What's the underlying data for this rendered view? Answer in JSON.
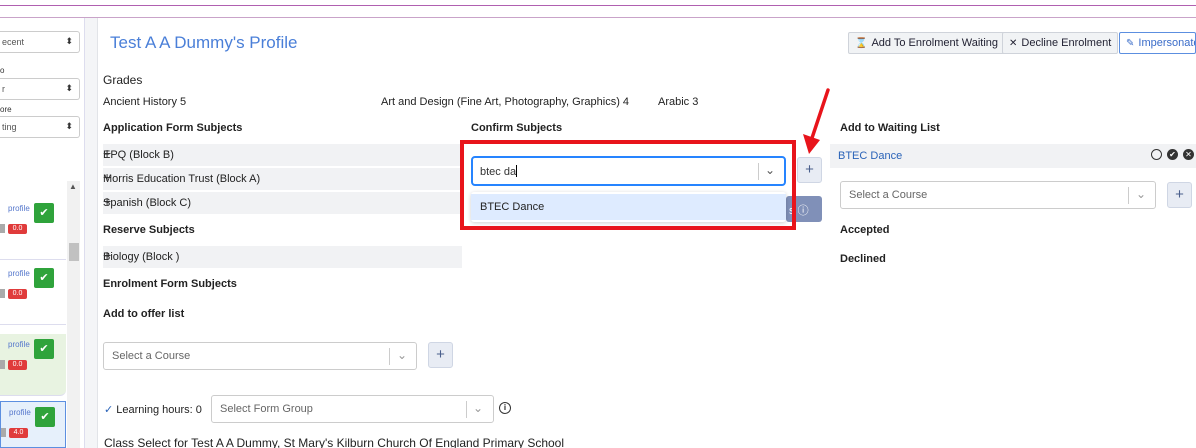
{
  "sidebar": {
    "select1": "ecent",
    "select2": "r",
    "select3": "ting",
    "label1": "o",
    "label2": "ore",
    "cards": [
      {
        "link": "profile",
        "score": "0.0"
      },
      {
        "link": "profile",
        "score": "0.0"
      },
      {
        "link": "profile",
        "score": "0.0"
      },
      {
        "link": "profile",
        "score": "4.0"
      }
    ]
  },
  "header": {
    "title": "Test A A Dummy's Profile",
    "add_waiting_label": "Add To Enrolment Waiting",
    "decline_label": "Decline Enrolment",
    "impersonate_label": "Impersonate"
  },
  "grades": {
    "heading": "Grades",
    "items": [
      "Ancient History 5",
      "Art and Design (Fine Art, Photography, Graphics) 4",
      "Arabic 3"
    ]
  },
  "application_form": {
    "heading": "Application Form Subjects",
    "items": [
      "EPQ (Block B)",
      "Morris Education Trust (Block A)",
      "Spanish (Block C)"
    ]
  },
  "reserve": {
    "heading": "Reserve Subjects",
    "items": [
      "Biology (Block )"
    ]
  },
  "enrolment_form": {
    "heading": "Enrolment Form Subjects"
  },
  "offer": {
    "heading": "Add to offer list",
    "placeholder": "Select a Course",
    "add": "+"
  },
  "confirm": {
    "heading": "Confirm Subjects",
    "search_value": "btec da",
    "option": "BTEC Dance",
    "add": "+",
    "hidden_btn": "s"
  },
  "waiting": {
    "heading": "Add to Waiting List",
    "item": "BTEC Dance",
    "placeholder": "Select a Course",
    "add": "+",
    "accepted": "Accepted",
    "declined": "Declined"
  },
  "footer": {
    "learning_hours": "Learning hours: 0",
    "form_group_placeholder": "Select Form Group",
    "class_select": "Class Select for Test A A Dummy, St Mary's Kilburn Church Of England Primary School"
  },
  "colors": {
    "highlight": "#e8141b",
    "accent": "#4a7fd8",
    "success": "#2fa33b"
  }
}
